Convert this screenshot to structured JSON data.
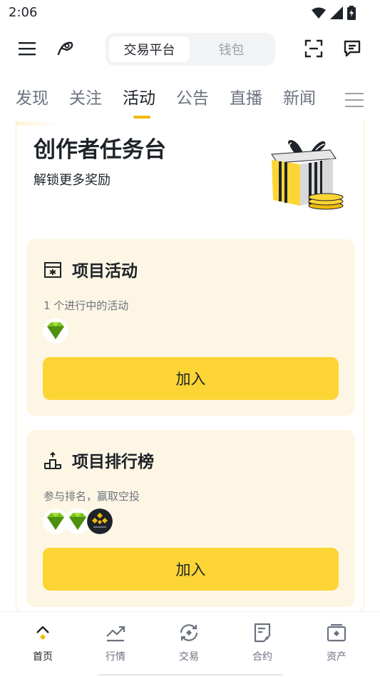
{
  "status_bar": {
    "time": "2:06"
  },
  "header": {
    "segments": {
      "active": "交易平台",
      "inactive": "钱包"
    }
  },
  "tabs": [
    {
      "label": "发现"
    },
    {
      "label": "关注"
    },
    {
      "label": "活动"
    },
    {
      "label": "公告"
    },
    {
      "label": "直播"
    },
    {
      "label": "新闻"
    }
  ],
  "active_tab": "活动",
  "card": {
    "title": "创作者任务台",
    "subtitle": "解锁更多奖励"
  },
  "sections": [
    {
      "title": "项目活动",
      "description": "1 个进行中的活动",
      "button_label": "加入",
      "icon": "project-activity-icon",
      "tokens": [
        "green-gem-token"
      ]
    },
    {
      "title": "项目排行榜",
      "description": "参与排名，赢取空投",
      "button_label": "加入",
      "icon": "leaderboard-icon",
      "tokens": [
        "green-gem-token",
        "green-gem-token",
        "binance-token"
      ]
    }
  ],
  "bottom_nav": [
    {
      "label": "首页",
      "icon": "home-icon",
      "active": true
    },
    {
      "label": "行情",
      "icon": "markets-icon",
      "active": false
    },
    {
      "label": "交易",
      "icon": "trade-icon",
      "active": false
    },
    {
      "label": "合约",
      "icon": "futures-icon",
      "active": false
    },
    {
      "label": "资产",
      "icon": "wallet-icon",
      "active": false
    }
  ],
  "colors": {
    "accent": "#fcd535",
    "indicator": "#f0b90b",
    "section_bg": "#fef6e4",
    "text": "#1e2329",
    "muted": "#6b7280"
  }
}
